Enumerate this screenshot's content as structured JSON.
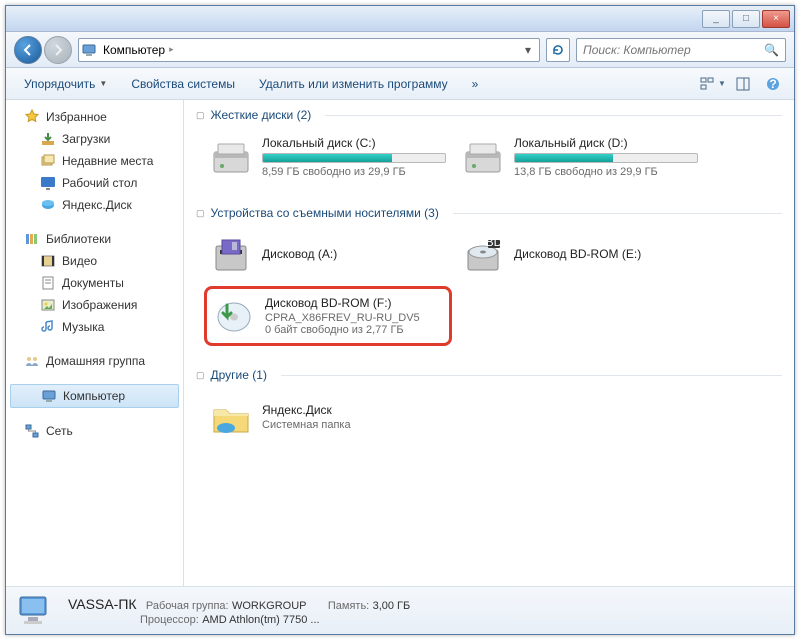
{
  "titlebar": {
    "minimize": "_",
    "maximize": "□",
    "close": "×"
  },
  "nav": {
    "breadcrumb": [
      "Компьютер"
    ],
    "search_placeholder": "Поиск: Компьютер"
  },
  "toolbar": {
    "organize": "Упорядочить",
    "system_props": "Свойства системы",
    "uninstall": "Удалить или изменить программу",
    "overflow": "»"
  },
  "sidebar": {
    "favorites": {
      "label": "Избранное",
      "items": [
        "Загрузки",
        "Недавние места",
        "Рабочий стол",
        "Яндекс.Диск"
      ]
    },
    "libraries": {
      "label": "Библиотеки",
      "items": [
        "Видео",
        "Документы",
        "Изображения",
        "Музыка"
      ]
    },
    "homegroup": {
      "label": "Домашняя группа"
    },
    "computer": {
      "label": "Компьютер"
    },
    "network": {
      "label": "Сеть"
    }
  },
  "groups": [
    {
      "title": "Жесткие диски",
      "count": 2,
      "items": [
        {
          "name": "Локальный диск (C:)",
          "free_text": "8,59 ГБ свободно из 29,9 ГБ",
          "fill_pct": 71,
          "icon": "hdd"
        },
        {
          "name": "Локальный диск (D:)",
          "free_text": "13,8 ГБ свободно из 29,9 ГБ",
          "fill_pct": 54,
          "icon": "hdd"
        }
      ]
    },
    {
      "title": "Устройства со съемными носителями",
      "count": 3,
      "items": [
        {
          "name": "Дисковод (A:)",
          "icon": "floppy"
        },
        {
          "name": "Дисковод BD-ROM (E:)",
          "icon": "bdrom"
        },
        {
          "name": "Дисковод BD-ROM (F:)",
          "sub": "CPRA_X86FREV_RU-RU_DV5",
          "free_text": "0 байт свободно из 2,77 ГБ",
          "icon": "disc-install",
          "highlight": true
        }
      ]
    },
    {
      "title": "Другие",
      "count": 1,
      "items": [
        {
          "name": "Яндекс.Диск",
          "sub": "Системная папка",
          "icon": "folder-yd"
        }
      ]
    }
  ],
  "status": {
    "name": "VASSA-ПК",
    "workgroup_label": "Рабочая группа:",
    "workgroup": "WORKGROUP",
    "memory_label": "Память:",
    "memory": "3,00 ГБ",
    "cpu_label": "Процессор:",
    "cpu": "AMD Athlon(tm) 7750 ..."
  }
}
